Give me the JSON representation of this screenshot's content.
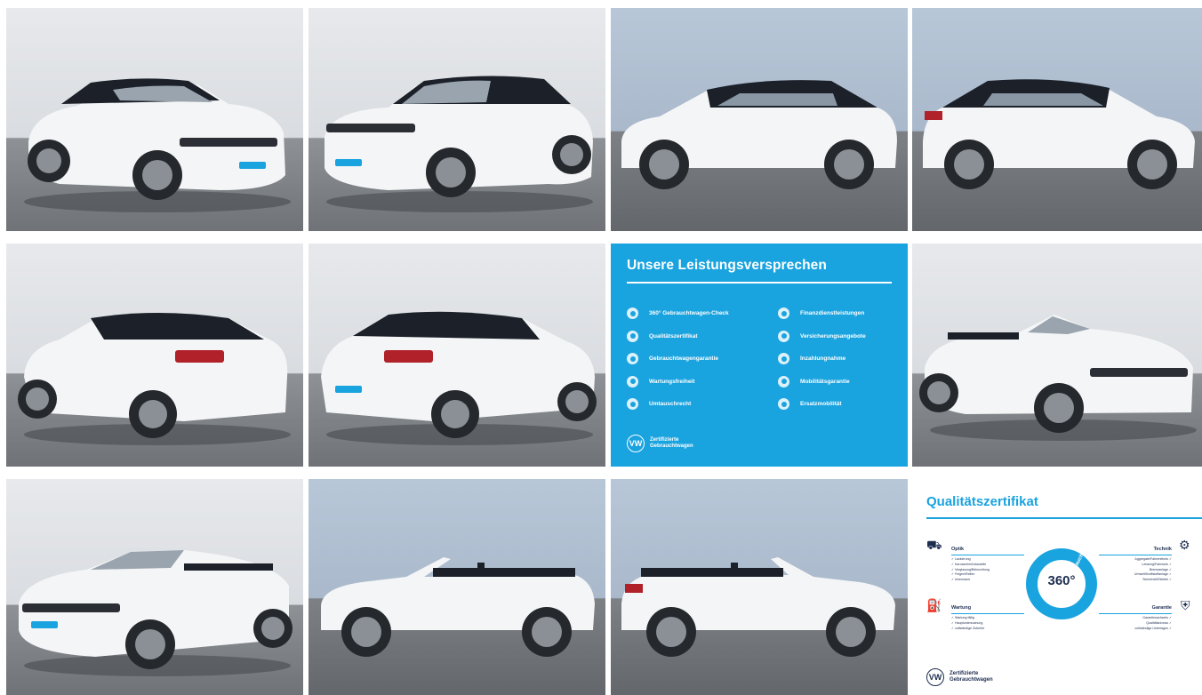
{
  "gallery": {
    "photos": [
      {
        "name": "car-photo-front-left",
        "view": "front-left"
      },
      {
        "name": "car-photo-front-right",
        "view": "front-right"
      },
      {
        "name": "car-photo-side-left",
        "view": "side-left"
      },
      {
        "name": "car-photo-side-right",
        "view": "side-right"
      },
      {
        "name": "car-photo-rear-left",
        "view": "rear-left"
      },
      {
        "name": "car-photo-rear-right",
        "view": "rear-right"
      },
      {
        "name": "car-photo-open-front-left",
        "view": "open-front-left"
      },
      {
        "name": "car-photo-open-front-right",
        "view": "open-front-right"
      },
      {
        "name": "car-photo-open-side-left",
        "view": "open-side-left"
      },
      {
        "name": "car-photo-open-side-right",
        "view": "open-side-right"
      }
    ],
    "colors": {
      "body": "#f4f5f6",
      "roof": "#1b2029",
      "accent": "#19a3df",
      "navy": "#1d2d50"
    }
  },
  "promise": {
    "title": "Unsere Leistungsversprechen",
    "left_items": [
      "360° Gebrauchtwagen-Check",
      "Qualitätszertifikat",
      "Gebrauchtwagengarantie",
      "Wartungsfreiheit",
      "Umtauschrecht"
    ],
    "right_items": [
      "Finanzdienstleistungen",
      "Versicherungsangebote",
      "Inzahlungnahme",
      "Mobilitätsgarantie",
      "Ersatzmobilität"
    ],
    "logo_line1": "Zertifizierte",
    "logo_line2": "Gebrauchtwagen",
    "logo_mark": "VW"
  },
  "certificate": {
    "title": "Qualitätszertifikat",
    "center_number": "360°",
    "ring_label": "Gebrauchtwagen-Check",
    "optik": {
      "label": "Optik",
      "items": [
        "✓ Lackierung",
        "✓ Karosserie/Anbauteile",
        "✓ Verglasung/Beleuchtung",
        "✓ Felgen/Reifen",
        "✓ Innenraum"
      ]
    },
    "technik": {
      "label": "Technik",
      "items": [
        "Aggregate/Fahrerlebnis ✓",
        "Leistung/Fahrwerk ✓",
        "Bremsanlage ✓",
        "Umwelt/Kraftstoffanlage ✓",
        "Sicherheit/Elektrik ✓"
      ]
    },
    "wartung": {
      "label": "Wartung",
      "items": [
        "✓ Wartung fällig",
        "✓ Hauptuntersuchung",
        "✓ vollständige Zubehör"
      ]
    },
    "garantie": {
      "label": "Garantie",
      "items": [
        "Garantienachweis ✓",
        "Qualitätsniveau ✓",
        "vollständige Unterlagen ✓"
      ]
    },
    "logo_line1": "Zertifizierte",
    "logo_line2": "Gebrauchtwagen",
    "logo_mark": "VW"
  }
}
